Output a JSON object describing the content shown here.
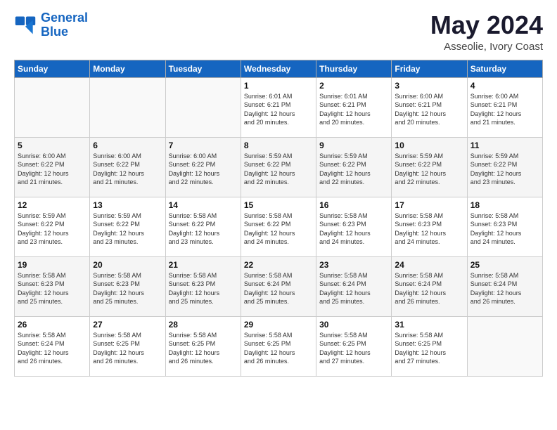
{
  "logo": {
    "line1": "General",
    "line2": "Blue"
  },
  "header": {
    "month": "May 2024",
    "location": "Asseolie, Ivory Coast"
  },
  "weekdays": [
    "Sunday",
    "Monday",
    "Tuesday",
    "Wednesday",
    "Thursday",
    "Friday",
    "Saturday"
  ],
  "weeks": [
    [
      {
        "day": "",
        "info": ""
      },
      {
        "day": "",
        "info": ""
      },
      {
        "day": "",
        "info": ""
      },
      {
        "day": "1",
        "info": "Sunrise: 6:01 AM\nSunset: 6:21 PM\nDaylight: 12 hours\nand 20 minutes."
      },
      {
        "day": "2",
        "info": "Sunrise: 6:01 AM\nSunset: 6:21 PM\nDaylight: 12 hours\nand 20 minutes."
      },
      {
        "day": "3",
        "info": "Sunrise: 6:00 AM\nSunset: 6:21 PM\nDaylight: 12 hours\nand 20 minutes."
      },
      {
        "day": "4",
        "info": "Sunrise: 6:00 AM\nSunset: 6:21 PM\nDaylight: 12 hours\nand 21 minutes."
      }
    ],
    [
      {
        "day": "5",
        "info": "Sunrise: 6:00 AM\nSunset: 6:22 PM\nDaylight: 12 hours\nand 21 minutes."
      },
      {
        "day": "6",
        "info": "Sunrise: 6:00 AM\nSunset: 6:22 PM\nDaylight: 12 hours\nand 21 minutes."
      },
      {
        "day": "7",
        "info": "Sunrise: 6:00 AM\nSunset: 6:22 PM\nDaylight: 12 hours\nand 22 minutes."
      },
      {
        "day": "8",
        "info": "Sunrise: 5:59 AM\nSunset: 6:22 PM\nDaylight: 12 hours\nand 22 minutes."
      },
      {
        "day": "9",
        "info": "Sunrise: 5:59 AM\nSunset: 6:22 PM\nDaylight: 12 hours\nand 22 minutes."
      },
      {
        "day": "10",
        "info": "Sunrise: 5:59 AM\nSunset: 6:22 PM\nDaylight: 12 hours\nand 22 minutes."
      },
      {
        "day": "11",
        "info": "Sunrise: 5:59 AM\nSunset: 6:22 PM\nDaylight: 12 hours\nand 23 minutes."
      }
    ],
    [
      {
        "day": "12",
        "info": "Sunrise: 5:59 AM\nSunset: 6:22 PM\nDaylight: 12 hours\nand 23 minutes."
      },
      {
        "day": "13",
        "info": "Sunrise: 5:59 AM\nSunset: 6:22 PM\nDaylight: 12 hours\nand 23 minutes."
      },
      {
        "day": "14",
        "info": "Sunrise: 5:58 AM\nSunset: 6:22 PM\nDaylight: 12 hours\nand 23 minutes."
      },
      {
        "day": "15",
        "info": "Sunrise: 5:58 AM\nSunset: 6:22 PM\nDaylight: 12 hours\nand 24 minutes."
      },
      {
        "day": "16",
        "info": "Sunrise: 5:58 AM\nSunset: 6:23 PM\nDaylight: 12 hours\nand 24 minutes."
      },
      {
        "day": "17",
        "info": "Sunrise: 5:58 AM\nSunset: 6:23 PM\nDaylight: 12 hours\nand 24 minutes."
      },
      {
        "day": "18",
        "info": "Sunrise: 5:58 AM\nSunset: 6:23 PM\nDaylight: 12 hours\nand 24 minutes."
      }
    ],
    [
      {
        "day": "19",
        "info": "Sunrise: 5:58 AM\nSunset: 6:23 PM\nDaylight: 12 hours\nand 25 minutes."
      },
      {
        "day": "20",
        "info": "Sunrise: 5:58 AM\nSunset: 6:23 PM\nDaylight: 12 hours\nand 25 minutes."
      },
      {
        "day": "21",
        "info": "Sunrise: 5:58 AM\nSunset: 6:23 PM\nDaylight: 12 hours\nand 25 minutes."
      },
      {
        "day": "22",
        "info": "Sunrise: 5:58 AM\nSunset: 6:24 PM\nDaylight: 12 hours\nand 25 minutes."
      },
      {
        "day": "23",
        "info": "Sunrise: 5:58 AM\nSunset: 6:24 PM\nDaylight: 12 hours\nand 25 minutes."
      },
      {
        "day": "24",
        "info": "Sunrise: 5:58 AM\nSunset: 6:24 PM\nDaylight: 12 hours\nand 26 minutes."
      },
      {
        "day": "25",
        "info": "Sunrise: 5:58 AM\nSunset: 6:24 PM\nDaylight: 12 hours\nand 26 minutes."
      }
    ],
    [
      {
        "day": "26",
        "info": "Sunrise: 5:58 AM\nSunset: 6:24 PM\nDaylight: 12 hours\nand 26 minutes."
      },
      {
        "day": "27",
        "info": "Sunrise: 5:58 AM\nSunset: 6:25 PM\nDaylight: 12 hours\nand 26 minutes."
      },
      {
        "day": "28",
        "info": "Sunrise: 5:58 AM\nSunset: 6:25 PM\nDaylight: 12 hours\nand 26 minutes."
      },
      {
        "day": "29",
        "info": "Sunrise: 5:58 AM\nSunset: 6:25 PM\nDaylight: 12 hours\nand 26 minutes."
      },
      {
        "day": "30",
        "info": "Sunrise: 5:58 AM\nSunset: 6:25 PM\nDaylight: 12 hours\nand 27 minutes."
      },
      {
        "day": "31",
        "info": "Sunrise: 5:58 AM\nSunset: 6:25 PM\nDaylight: 12 hours\nand 27 minutes."
      },
      {
        "day": "",
        "info": ""
      }
    ]
  ]
}
